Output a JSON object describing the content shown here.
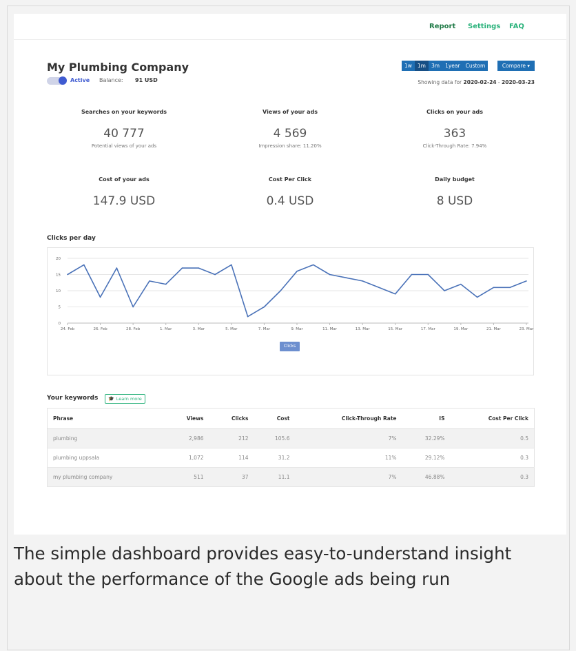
{
  "nav": {
    "report": "Report",
    "settings": "Settings",
    "faq": "FAQ"
  },
  "account": {
    "company": "My Plumbing Company",
    "status": "Active",
    "balance_label": "Balance:",
    "balance_value": "91 USD"
  },
  "range": {
    "options": [
      "1w",
      "1m",
      "3m",
      "1year",
      "Custom"
    ],
    "selected": "1m",
    "compare_label": "Compare ▾",
    "showing_prefix": "Showing data for",
    "start": "2020-02-24",
    "separator": "-",
    "end": "2020-03-23"
  },
  "stats": [
    {
      "title": "Searches on your keywords",
      "value": "40 777",
      "sub": "Potential views of your ads"
    },
    {
      "title": "Views of your ads",
      "value": "4 569",
      "sub": "Impression share: 11.20%"
    },
    {
      "title": "Clicks on your ads",
      "value": "363",
      "sub": "Click-Through Rate: 7.94%"
    },
    {
      "title": "Cost of your ads",
      "value": "147.9 USD",
      "sub": ""
    },
    {
      "title": "Cost Per Click",
      "value": "0.4 USD",
      "sub": ""
    },
    {
      "title": "Daily budget",
      "value": "8 USD",
      "sub": ""
    }
  ],
  "chart_section_title": "Clicks per day",
  "chart_data": {
    "type": "line",
    "title": "Clicks per day",
    "xlabel": "",
    "ylabel": "",
    "x": [
      "24. Feb",
      "25. Feb",
      "26. Feb",
      "27. Feb",
      "28. Feb",
      "29. Feb",
      "1. Mar",
      "2. Mar",
      "3. Mar",
      "4. Mar",
      "5. Mar",
      "6. Mar",
      "7. Mar",
      "8. Mar",
      "9. Mar",
      "10. Mar",
      "11. Mar",
      "12. Mar",
      "13. Mar",
      "14. Mar",
      "15. Mar",
      "16. Mar",
      "17. Mar",
      "18. Mar",
      "19. Mar",
      "20. Mar",
      "21. Mar",
      "22. Mar",
      "23. Mar"
    ],
    "x_tick_labels": [
      "24. Feb",
      "26. Feb",
      "28. Feb",
      "1. Mar",
      "3. Mar",
      "5. Mar",
      "7. Mar",
      "9. Mar",
      "11. Mar",
      "13. Mar",
      "15. Mar",
      "17. Mar",
      "19. Mar",
      "21. Mar",
      "23. Mar"
    ],
    "series": [
      {
        "name": "Clicks",
        "color": "#4a72b8",
        "values": [
          15,
          18,
          8,
          17,
          5,
          13,
          12,
          17,
          17,
          15,
          18,
          2,
          5,
          10,
          16,
          18,
          15,
          14,
          13,
          11,
          9,
          15,
          15,
          10,
          12,
          8,
          11,
          11,
          13
        ]
      }
    ],
    "ylim": [
      0,
      20
    ],
    "yticks": [
      0,
      5,
      10,
      15,
      20
    ],
    "grid": true,
    "legend": "bottom-center"
  },
  "keywords": {
    "title": "Your keywords",
    "learn_more": "Learn more",
    "columns": [
      "Phrase",
      "Views",
      "Clicks",
      "Cost",
      "Click-Through Rate",
      "IS",
      "Cost Per Click"
    ],
    "rows": [
      [
        "plumbing",
        "2,986",
        "212",
        "105.6",
        "7%",
        "32.29%",
        "0.5"
      ],
      [
        "plumbing uppsala",
        "1,072",
        "114",
        "31.2",
        "11%",
        "29.12%",
        "0.3"
      ],
      [
        "my plumbing company",
        "511",
        "37",
        "11.1",
        "7%",
        "46.88%",
        "0.3"
      ]
    ]
  },
  "caption": "The simple dashboard provides easy-to-understand insight about the performance of the Google ads being run",
  "colors": {
    "accent_green": "#2ab27b",
    "primary_blue": "#1f6fb4",
    "series_blue": "#4a72b8"
  }
}
